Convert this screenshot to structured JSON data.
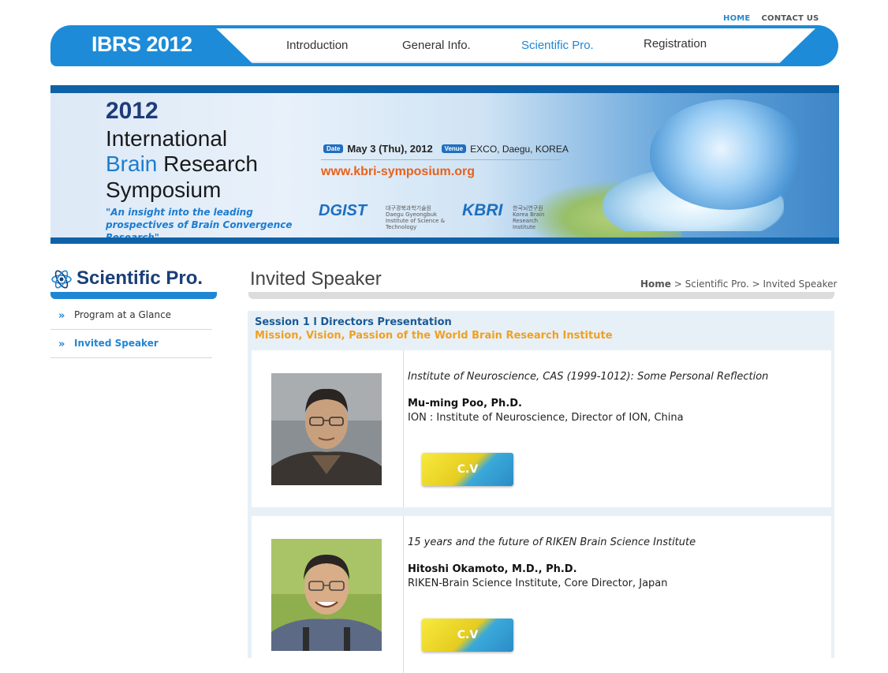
{
  "util_links": {
    "home": "HOME",
    "contact": "CONTACT US"
  },
  "nav": {
    "logo": "IBRS 2012",
    "items": [
      {
        "label": "Introduction"
      },
      {
        "label": "General Info."
      },
      {
        "label": "Scientific Pro."
      },
      {
        "label": "Registration"
      }
    ],
    "active_item": "Scientific Pro."
  },
  "banner": {
    "year": "2012",
    "title_line1": "International",
    "title_line2_a": "Brain",
    "title_line2_b": " Research",
    "title_line3": "Symposium",
    "quote": "\"An insight into the leading prospectives of Brain Convergence Research\"",
    "date_tag": "Date",
    "date": "May 3 (Thu), 2012",
    "venue_tag": "Venue",
    "venue": "EXCO, Daegu, KOREA",
    "url": "www.kbri-symposium.org",
    "logo1": "DGIST",
    "logo1_sub": "대구경북과학기술원 Daegu Gyeongbuk Institute of Science & Technology",
    "logo2": "KBRI",
    "logo2_sub": "한국뇌연구원 Korea Brain Research Institute"
  },
  "sidebar": {
    "title": "Scientific Pro.",
    "items": [
      {
        "label": "Program at a Glance"
      },
      {
        "label": "Invited Speaker"
      }
    ],
    "active_item": "Invited Speaker"
  },
  "main": {
    "page_title": "Invited Speaker",
    "breadcrumb": {
      "home": "Home",
      "sep": " > ",
      "level1": "Scientific Pro.",
      "level2": "Invited Speaker"
    },
    "session": {
      "title": "Session 1 l Directors Presentation",
      "subtitle": "Mission, Vision, Passion of the World Brain Research Institute"
    },
    "speakers": [
      {
        "talk": "Institute of Neuroscience, CAS (1999-1012): Some Personal Reflection",
        "name": "Mu-ming Poo, Ph.D.",
        "affiliation": "ION : Institute of Neuroscience, Director of ION, China",
        "cv_label": "C.V"
      },
      {
        "talk": "15 years and the future of RIKEN Brain Science Institute",
        "name": "Hitoshi Okamoto, M.D., Ph.D.",
        "affiliation": "RIKEN-Brain Science Institute, Core Director, Japan",
        "cv_label": "C.V"
      }
    ]
  },
  "colors": {
    "brand_blue": "#1d8bd8",
    "accent_orange": "#f0a020",
    "session_bg": "#e8f0f7"
  }
}
